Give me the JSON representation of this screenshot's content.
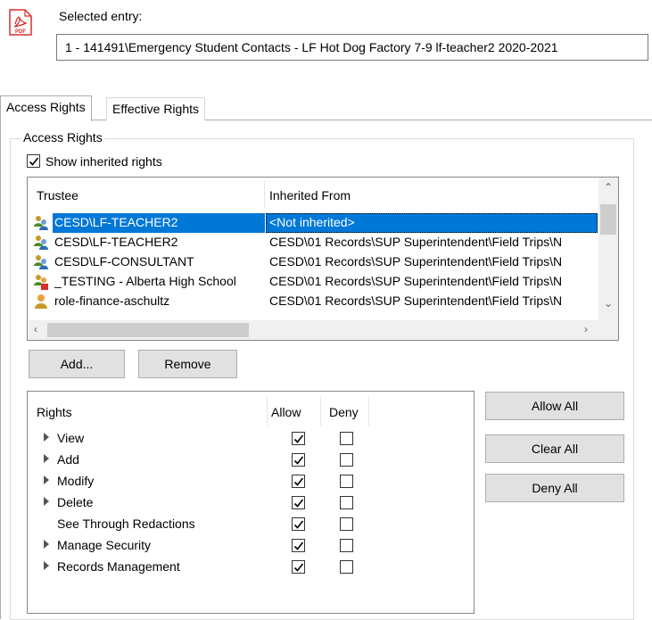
{
  "header": {
    "selected_label": "Selected entry:",
    "selected_value": "1 - 141491\\Emergency Student Contacts - LF Hot Dog Factory 7-9 lf-teacher2 2020-2021",
    "file_icon_text": "PDF"
  },
  "tabs": [
    {
      "label": "Access Rights",
      "active": true
    },
    {
      "label": "Effective Rights",
      "active": false
    }
  ],
  "access_rights_group": {
    "legend": "Access Rights",
    "show_inherited_label": "Show inherited rights",
    "show_inherited_checked": true
  },
  "trustee_list": {
    "columns": [
      "Trustee",
      "Inherited From"
    ],
    "rows": [
      {
        "trustee": "CESD\\LF-TEACHER2",
        "inherited_from": "<Not inherited>",
        "icon": "user-group-icon",
        "selected": true
      },
      {
        "trustee": "CESD\\LF-TEACHER2",
        "inherited_from": "CESD\\01 Records\\SUP Superintendent\\Field Trips\\N",
        "icon": "user-group-icon",
        "selected": false
      },
      {
        "trustee": "CESD\\LF-CONSULTANT",
        "inherited_from": "CESD\\01 Records\\SUP Superintendent\\Field Trips\\N",
        "icon": "user-group-icon",
        "selected": false
      },
      {
        "trustee": "_TESTING - Alberta High School",
        "inherited_from": "CESD\\01 Records\\SUP Superintendent\\Field Trips\\N",
        "icon": "user-group-locked-icon",
        "selected": false
      },
      {
        "trustee": "role-finance-aschultz",
        "inherited_from": "CESD\\01 Records\\SUP Superintendent\\Field Trips\\N",
        "icon": "user-role-icon",
        "selected": false
      }
    ]
  },
  "buttons": {
    "add": "Add...",
    "remove": "Remove",
    "allow_all": "Allow All",
    "clear_all": "Clear All",
    "deny_all": "Deny All"
  },
  "rights": {
    "columns": [
      "Rights",
      "Allow",
      "Deny"
    ],
    "items": [
      {
        "label": "View",
        "expandable": true,
        "allow": true,
        "deny": false
      },
      {
        "label": "Add",
        "expandable": true,
        "allow": true,
        "deny": false
      },
      {
        "label": "Modify",
        "expandable": true,
        "allow": true,
        "deny": false
      },
      {
        "label": "Delete",
        "expandable": true,
        "allow": true,
        "deny": false
      },
      {
        "label": "See Through Redactions",
        "expandable": false,
        "allow": true,
        "deny": false
      },
      {
        "label": "Manage Security",
        "expandable": true,
        "allow": true,
        "deny": false
      },
      {
        "label": "Records Management",
        "expandable": true,
        "allow": true,
        "deny": false
      }
    ]
  },
  "colors": {
    "selection": "#0078d7",
    "button_face": "#e1e1e1",
    "pdf_red": "#d9302c"
  }
}
